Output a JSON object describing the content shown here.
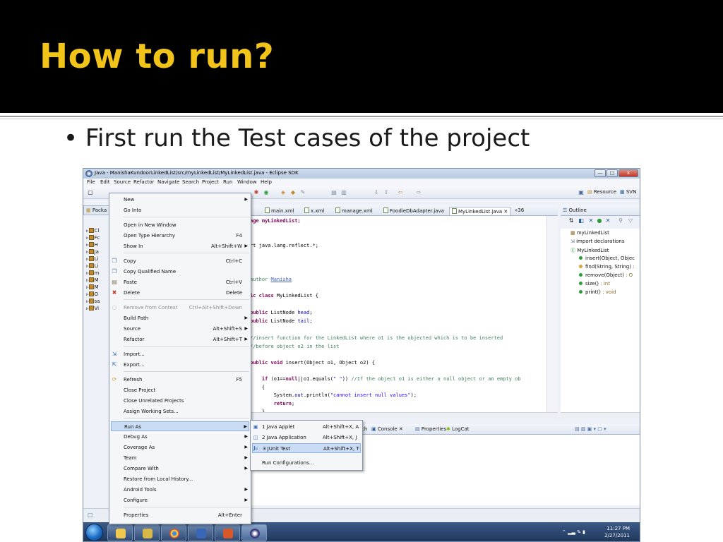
{
  "slide": {
    "title": "How to run?",
    "bullet": "First run the Test cases of the project"
  },
  "window": {
    "title": "Java - ManishaKundoorLinkedList/src/myLinkedList/MyLinkedList.java - Eclipse SDK",
    "controls": {
      "minimize": "—",
      "maximize": "□",
      "close": "x"
    }
  },
  "menubar": [
    "File",
    "Edit",
    "Source",
    "Refactor",
    "Navigate",
    "Search",
    "Project",
    "Run",
    "Window",
    "Help"
  ],
  "toolbar": {
    "resource": "Resource",
    "svn": "SVN"
  },
  "package_explorer": {
    "tab_label": "Packa",
    "rows": [
      "Cl",
      "Fc",
      "H",
      "Ja",
      "Li",
      "Li",
      "m",
      "M",
      "M",
      "O",
      "sa",
      "Vi"
    ]
  },
  "editor": {
    "tabs": [
      "main.xml",
      "x.xml",
      "manage.xml",
      "FoodieDbAdapter.java",
      "MyLinkedList.java",
      "»36"
    ],
    "code": {
      "l1": "age myLinkedList;",
      "l2": "rt java.lang.reflect.*;",
      "l3a": "author ",
      "l3b": "Manisha",
      "l4a": "ic class",
      "l4b": " MyLinkedList {",
      "l5a": "public",
      "l5b": " ListNode ",
      "l5c": "head",
      "l6a": "public",
      "l6b": " ListNode ",
      "l6c": "tail",
      "l7": "//insert function for the LinkedList where o1 is the objected which is to be inserted",
      "l8": "//before object o2 in the list",
      "l9a": "public void",
      "l9b": " insert(Object o1, Object o2) {",
      "l10a": "    if",
      "l10b": " (o1==",
      "l10c": "null",
      "l10d": "||o1.equals(",
      "l10e": "\" \"",
      "l10f": ")) ",
      "l10g": "//If the object o1 is either a null object or an empty ob",
      "l11": "    {",
      "l12a": "        System.",
      "l12b": "out",
      "l12c": ".println(",
      "l12d": "\"cannot insert null values\"",
      "l12e": ");",
      "l13a": "        return",
      "l13b": ";",
      "l14": "    }"
    }
  },
  "outline": {
    "title": "Outline",
    "items": [
      {
        "name": "myLinkedList",
        "ret": ""
      },
      {
        "name": "import declarations",
        "ret": ""
      },
      {
        "name": "MyLinkedList",
        "ret": ""
      },
      {
        "name": "insert(Object, Objec",
        "ret": ""
      },
      {
        "name": "find(String, String) ",
        "ret": ":"
      },
      {
        "name": "remove(Object)",
        "ret": " : O"
      },
      {
        "name": "size()",
        "ret": " : int"
      },
      {
        "name": "print()",
        "ret": " : void"
      }
    ]
  },
  "console_tabs": [
    "ch",
    "Console",
    "Properties",
    "LogCat"
  ],
  "context_menu": {
    "items": [
      {
        "label": "New",
        "shortcut": "",
        "submenu": true
      },
      {
        "label": "Go Into",
        "shortcut": ""
      },
      {
        "label": "Open in New Window",
        "shortcut": ""
      },
      {
        "label": "Open Type Hierarchy",
        "shortcut": "F4"
      },
      {
        "label": "Show In",
        "shortcut": "Alt+Shift+W",
        "submenu": true
      },
      {
        "label": "Copy",
        "shortcut": "Ctrl+C"
      },
      {
        "label": "Copy Qualified Name",
        "shortcut": ""
      },
      {
        "label": "Paste",
        "shortcut": "Ctrl+V"
      },
      {
        "label": "Delete",
        "shortcut": "Delete"
      },
      {
        "label": "Remove from Context",
        "shortcut": "Ctrl+Alt+Shift+Down"
      },
      {
        "label": "Build Path",
        "shortcut": "",
        "submenu": true
      },
      {
        "label": "Source",
        "shortcut": "Alt+Shift+S",
        "submenu": true
      },
      {
        "label": "Refactor",
        "shortcut": "Alt+Shift+T",
        "submenu": true
      },
      {
        "label": "Import...",
        "shortcut": ""
      },
      {
        "label": "Export...",
        "shortcut": ""
      },
      {
        "label": "Refresh",
        "shortcut": "F5"
      },
      {
        "label": "Close Project",
        "shortcut": ""
      },
      {
        "label": "Close Unrelated Projects",
        "shortcut": ""
      },
      {
        "label": "Assign Working Sets...",
        "shortcut": ""
      },
      {
        "label": "Run As",
        "shortcut": "",
        "submenu": true
      },
      {
        "label": "Debug As",
        "shortcut": "",
        "submenu": true
      },
      {
        "label": "Coverage As",
        "shortcut": "",
        "submenu": true
      },
      {
        "label": "Team",
        "shortcut": "",
        "submenu": true
      },
      {
        "label": "Compare With",
        "shortcut": "",
        "submenu": true
      },
      {
        "label": "Restore from Local History...",
        "shortcut": ""
      },
      {
        "label": "Android Tools",
        "shortcut": "",
        "submenu": true
      },
      {
        "label": "Configure",
        "shortcut": "",
        "submenu": true
      },
      {
        "label": "Properties",
        "shortcut": "Alt+Enter"
      }
    ]
  },
  "run_as_submenu": {
    "items": [
      {
        "label": "1 Java Applet",
        "shortcut": "Alt+Shift+X, A"
      },
      {
        "label": "2 Java Application",
        "shortcut": "Alt+Shift+X, J"
      },
      {
        "label": "3 JUnit Test",
        "shortcut": "Alt+Shift+X, T"
      },
      {
        "label": "Run Configurations...",
        "shortcut": ""
      }
    ]
  },
  "taskbar": {
    "time": "11:27 PM",
    "date": "2/27/2011"
  }
}
